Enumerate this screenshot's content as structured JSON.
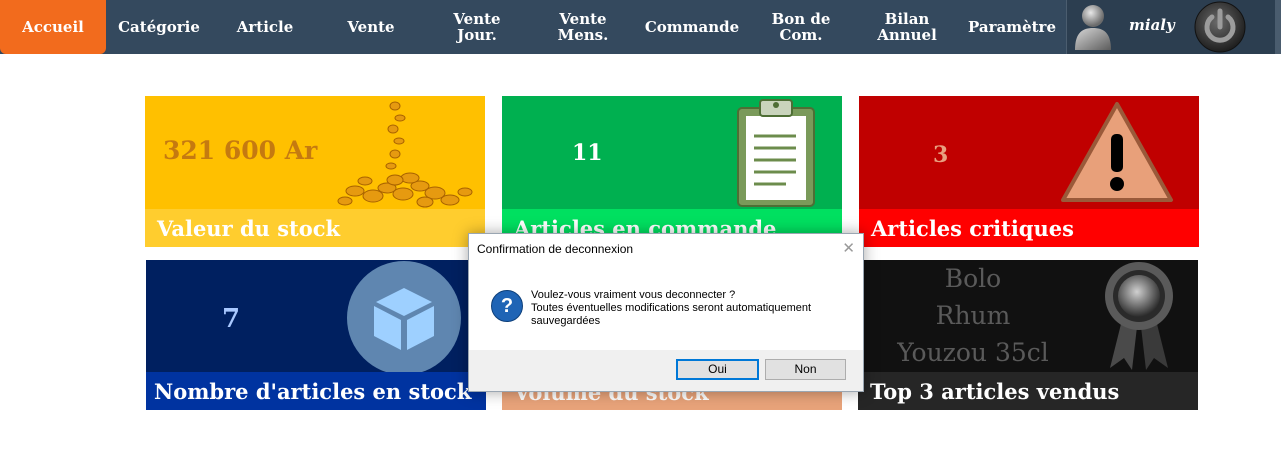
{
  "nav": {
    "items": [
      {
        "label": "Accueil",
        "active": true
      },
      {
        "label": "Catégorie"
      },
      {
        "label": "Article"
      },
      {
        "label": "Vente"
      },
      {
        "label": "Vente\nJour."
      },
      {
        "label": "Vente\nMens."
      },
      {
        "label": "Commande"
      },
      {
        "label": "Bon de\nCom."
      },
      {
        "label": "Bilan\nAnnuel"
      },
      {
        "label": "Paramètre"
      }
    ],
    "username": "mialy",
    "avatar_icon": "user-silhouette-icon",
    "power_icon": "power-icon"
  },
  "tiles": {
    "stock_value": {
      "value": "321 600 Ar",
      "label": "Valeur du stock",
      "color": "#ffc000",
      "label_bg": "#ffcd2e",
      "icon": "gold-coins-icon"
    },
    "orders": {
      "value": "11",
      "label": "Articles en commande",
      "color": "#00b050",
      "label_bg": "#00e060",
      "icon": "clipboard-icon"
    },
    "critical": {
      "value": "3",
      "label": "Articles critiques",
      "color": "#c00000",
      "label_bg": "#ff0000",
      "icon": "warning-icon"
    },
    "stock_count": {
      "value": "7",
      "label": "Nombre d'articles en stock",
      "color": "#002060",
      "label_bg": "#0033a0",
      "icon": "cube-icon"
    },
    "volume": {
      "label": "Volume du stock",
      "label_bg": "#e8a37a"
    },
    "top3": {
      "items": [
        "Bolo",
        "Rhum",
        "Youzou 35cl"
      ],
      "label": "Top 3 articles vendus",
      "color": "#111111",
      "label_bg": "#262626",
      "icon": "ribbon-medal-icon"
    }
  },
  "dialog": {
    "title": "Confirmation de deconnexion",
    "message": "Voulez-vous vraiment vous deconnecter ?\nToutes éventuelles modifications seront automatiquement sauvegardées",
    "yes": "Oui",
    "no": "Non",
    "icon": "question-icon"
  }
}
